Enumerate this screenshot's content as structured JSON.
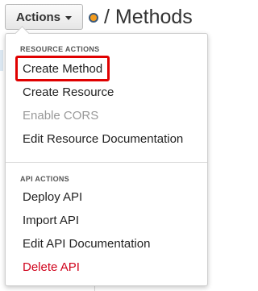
{
  "header": {
    "actions_label": "Actions",
    "title": "/ Methods"
  },
  "icons": {
    "caret": "chevron-down-icon",
    "status_dot": "orange-status-dot-icon"
  },
  "colors": {
    "status_dot": "#f39c1e",
    "highlight": "#e00000",
    "danger": "#d0021b",
    "disabled": "#999999"
  },
  "menu": {
    "resource_section": {
      "header": "RESOURCE ACTIONS",
      "items": [
        {
          "label": "Create Method",
          "state": "highlighted"
        },
        {
          "label": "Create Resource",
          "state": "normal"
        },
        {
          "label": "Enable CORS",
          "state": "disabled"
        },
        {
          "label": "Edit Resource Documentation",
          "state": "normal"
        }
      ]
    },
    "api_section": {
      "header": "API ACTIONS",
      "items": [
        {
          "label": "Deploy API",
          "state": "normal"
        },
        {
          "label": "Import API",
          "state": "normal"
        },
        {
          "label": "Edit API Documentation",
          "state": "normal"
        },
        {
          "label": "Delete API",
          "state": "danger"
        }
      ]
    }
  }
}
